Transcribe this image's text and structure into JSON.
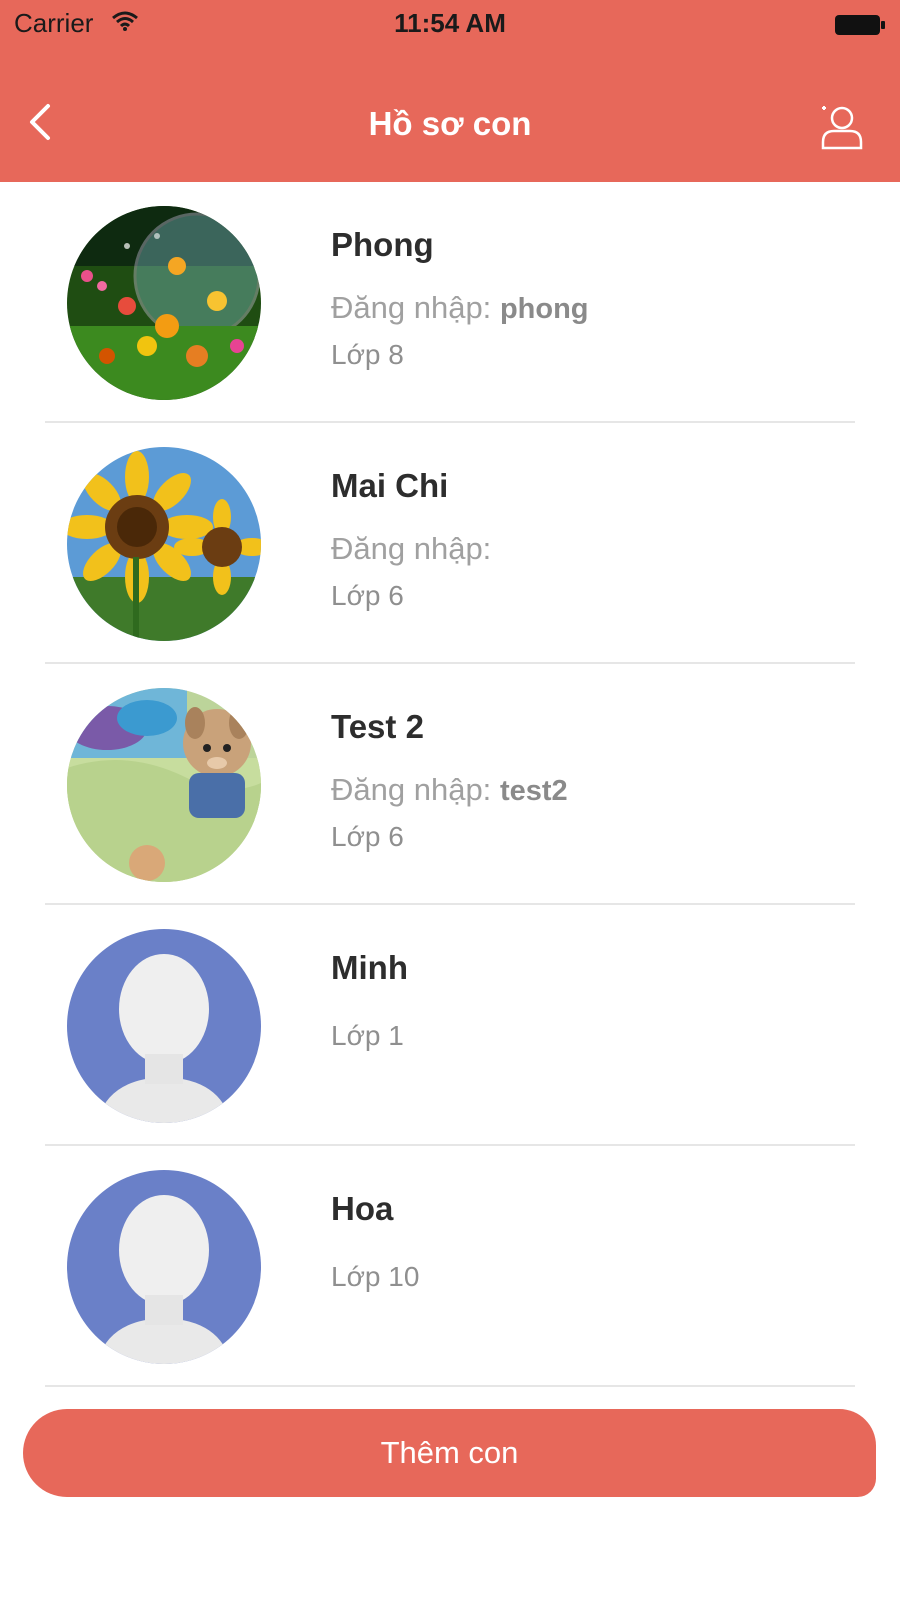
{
  "status_bar": {
    "carrier": "Carrier",
    "time": "11:54 AM",
    "wifi_icon": "wifi-icon",
    "battery_icon": "battery-icon"
  },
  "navbar": {
    "title": "Hồ sơ con",
    "back_icon": "chevron-left-icon",
    "profile_icon": "user-profile-icon",
    "background_color": "#e7685a"
  },
  "children": [
    {
      "name": "Phong",
      "login_label": "Đăng nhập:",
      "login_value": "phong",
      "grade": "Lớp 8",
      "avatar": "flowers-bubble-photo"
    },
    {
      "name": "Mai Chi",
      "login_label": "Đăng nhập:",
      "login_value": "",
      "grade": "Lớp 6",
      "avatar": "sunflower-photo"
    },
    {
      "name": "Test 2",
      "login_label": "Đăng nhập:",
      "login_value": "test2",
      "grade": "Lớp 6",
      "avatar": "plush-toys-photo"
    },
    {
      "name": "Minh",
      "grade": "Lớp 1",
      "avatar": "default-avatar"
    },
    {
      "name": "Hoa",
      "grade": "Lớp 10",
      "avatar": "default-avatar"
    }
  ],
  "add_button": {
    "label": "Thêm con",
    "color": "#e7685a"
  }
}
